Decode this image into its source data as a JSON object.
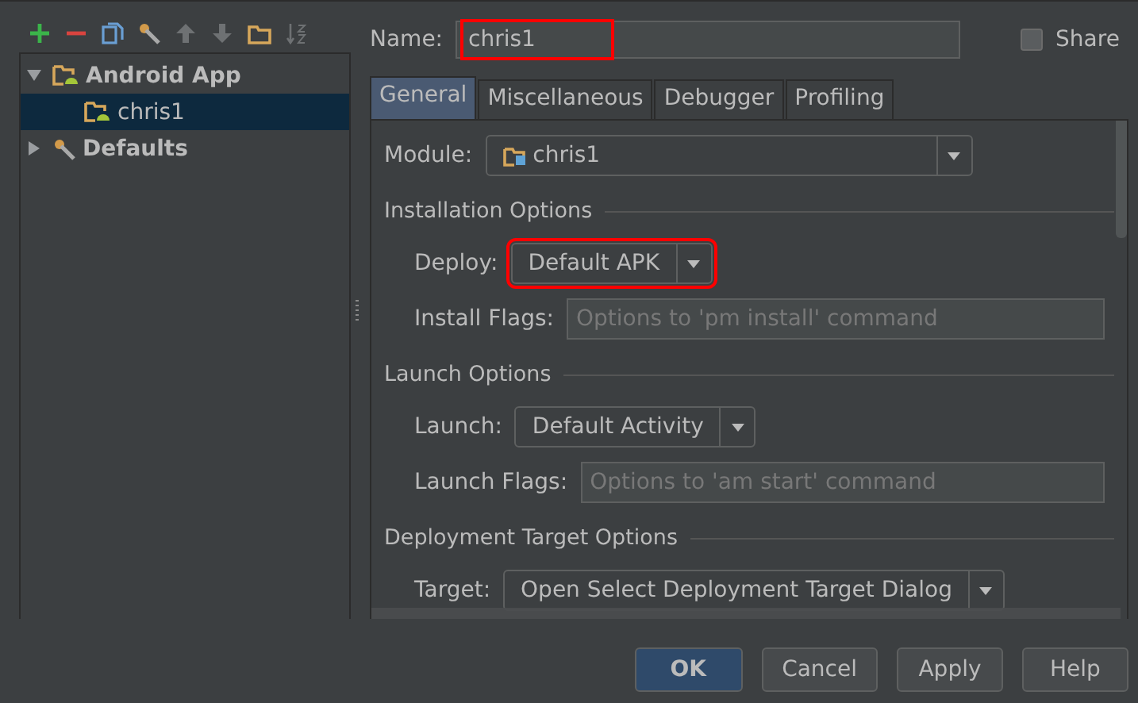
{
  "toolbar": [
    {
      "kind": "add"
    },
    {
      "kind": "remove"
    },
    {
      "kind": "copy"
    },
    {
      "kind": "edit-defaults"
    },
    {
      "kind": "up"
    },
    {
      "kind": "down"
    },
    {
      "kind": "folder"
    },
    {
      "kind": "sort"
    }
  ],
  "tree": [
    {
      "label": "Android App",
      "kind": "android",
      "expanded": true,
      "selected": false,
      "children": [
        {
          "label": "chris1",
          "kind": "android",
          "selected": true
        }
      ]
    },
    {
      "label": "Defaults",
      "kind": "wrench",
      "expanded": false,
      "selected": false
    }
  ],
  "name": {
    "label": "Name:",
    "value": "chris1",
    "highlighted": true
  },
  "share": {
    "label": "Share",
    "checked": false
  },
  "tabs": [
    {
      "label": "General",
      "selected": true
    },
    {
      "label": "Miscellaneous",
      "selected": false
    },
    {
      "label": "Debugger",
      "selected": false
    },
    {
      "label": "Profiling",
      "selected": false
    }
  ],
  "module": {
    "label": "Module:",
    "value": "chris1"
  },
  "sections": [
    {
      "title": "Installation Options",
      "rows": [
        {
          "kind": "dropdown",
          "label": "Deploy:",
          "value": "Default APK",
          "highlighted": true
        },
        {
          "kind": "field",
          "label": "Install Flags:",
          "placeholder": "Options to 'pm install' command"
        }
      ]
    },
    {
      "title": "Launch Options",
      "rows": [
        {
          "kind": "dropdown",
          "label": "Launch:",
          "value": "Default Activity",
          "highlighted": false
        },
        {
          "kind": "field",
          "label": "Launch Flags:",
          "placeholder": "Options to 'am start' command"
        }
      ]
    },
    {
      "title": "Deployment Target Options",
      "rows": [
        {
          "kind": "dropdown",
          "label": "Target:",
          "value": "Open Select Deployment Target Dialog",
          "highlighted": false
        }
      ]
    }
  ],
  "buttons": [
    {
      "label": "OK",
      "default": true
    },
    {
      "label": "Cancel",
      "default": false
    },
    {
      "label": "Apply",
      "default": false
    },
    {
      "label": "Help",
      "default": false
    }
  ]
}
